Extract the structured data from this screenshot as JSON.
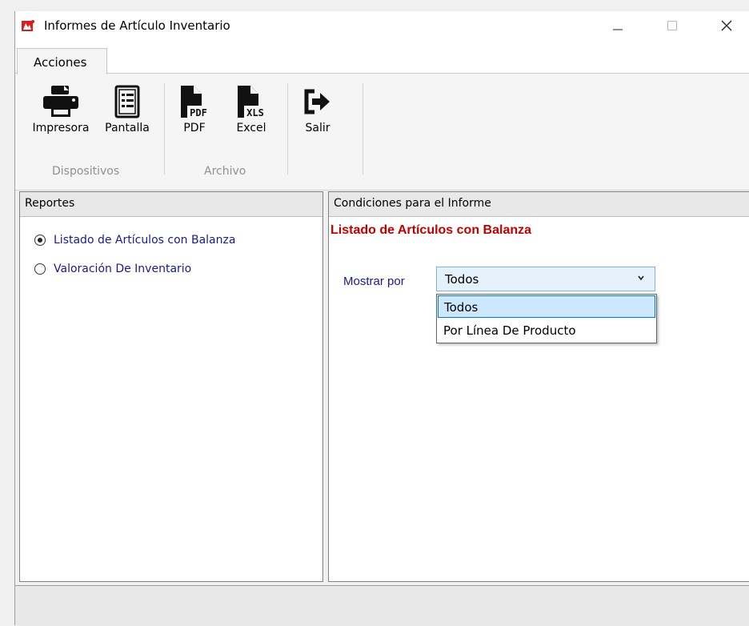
{
  "window": {
    "title": "Informes de Artículo Inventario",
    "controls": {
      "minimize": "minimize-icon",
      "maximize": "maximize-icon",
      "close": "close-icon"
    }
  },
  "ribbon": {
    "tabs": [
      {
        "label": "Acciones",
        "active": true
      }
    ],
    "groups": [
      {
        "label": "Dispositivos",
        "buttons": [
          {
            "label": "Impresora",
            "icon": "printer-icon"
          },
          {
            "label": "Pantalla",
            "icon": "screen-report-icon"
          }
        ]
      },
      {
        "label": "Archivo",
        "buttons": [
          {
            "label": "PDF",
            "icon": "pdf-file-icon",
            "badge": "PDF"
          },
          {
            "label": "Excel",
            "icon": "xls-file-icon",
            "badge": "XLS"
          }
        ]
      },
      {
        "label": "",
        "buttons": [
          {
            "label": "Salir",
            "icon": "exit-icon"
          }
        ]
      }
    ]
  },
  "reportes": {
    "header": "Reportes",
    "options": [
      {
        "label": "Listado de Artículos con Balanza",
        "checked": true
      },
      {
        "label": "Valoración De Inventario",
        "checked": false
      }
    ]
  },
  "condiciones": {
    "header": "Condiciones para el Informe",
    "title": "Listado de Artículos con Balanza",
    "mostrar_label": "Mostrar por",
    "combo_value": "Todos",
    "dropdown_options": [
      {
        "label": "Todos",
        "selected": true
      },
      {
        "label": "Por Línea De Producto",
        "selected": false
      }
    ]
  },
  "colors": {
    "accent_blue": "#0078d7",
    "label_navy": "#1a1a8c",
    "title_red": "#c00000",
    "selection": "#cce8ff"
  }
}
